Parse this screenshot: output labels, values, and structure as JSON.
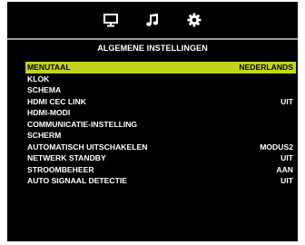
{
  "tabs": [
    {
      "icon": "monitor-icon",
      "active": true
    },
    {
      "icon": "music-note-icon",
      "active": false
    },
    {
      "icon": "gear-icon",
      "active": false
    }
  ],
  "colors": {
    "background": "#000000",
    "selection": "#c4d31d",
    "divider": "#9a9a9a"
  },
  "section_title": "ALGEMENE INSTELLINGEN",
  "menu": {
    "items": [
      {
        "label": "MENUTAAL",
        "value": "NEDERLANDS",
        "selected": true
      },
      {
        "label": "KLOK",
        "value": ""
      },
      {
        "label": "SCHEMA",
        "value": ""
      },
      {
        "label": "HDMI CEC LINK",
        "value": "UIT"
      },
      {
        "label": "HDMI-MODI",
        "value": ""
      },
      {
        "label": "COMMUNICATIE-INSTELLING",
        "value": ""
      },
      {
        "label": "SCHERM",
        "value": ""
      },
      {
        "label": "AUTOMATISCH UITSCHAKELEN",
        "value": "MODUS2"
      },
      {
        "label": "NETWERK STANDBY",
        "value": "UIT"
      },
      {
        "label": "STROOMBEHEER",
        "value": "AAN"
      },
      {
        "label": "AUTO SIGNAAL DETECTIE",
        "value": "UIT"
      }
    ]
  }
}
